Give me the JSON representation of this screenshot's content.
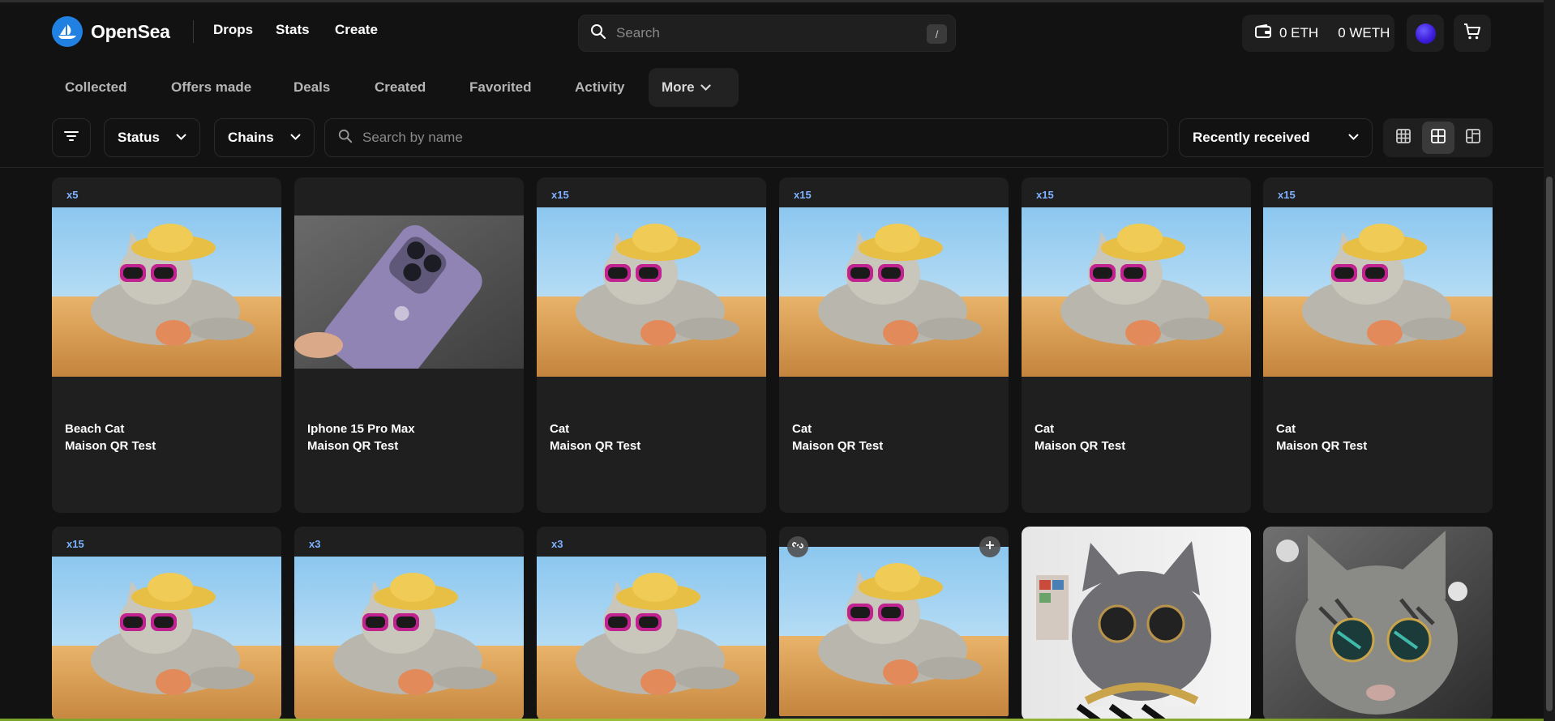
{
  "header": {
    "logo_text": "OpenSea",
    "nav": [
      "Drops",
      "Stats",
      "Create"
    ],
    "search_placeholder": "Search",
    "search_shortcut": "/",
    "wallet_eth": "0 ETH",
    "wallet_weth": "0 WETH"
  },
  "tabs": [
    "Collected",
    "Offers made",
    "Deals",
    "Created",
    "Favorited",
    "Activity",
    "More"
  ],
  "filters": {
    "status_label": "Status",
    "chains_label": "Chains",
    "search_placeholder": "Search by name",
    "sort_label": "Recently received"
  },
  "cards": [
    {
      "badge": "x5",
      "name": "Beach Cat",
      "collection": "Maison QR Test",
      "image": "beach-cat"
    },
    {
      "badge": "",
      "name": "Iphone 15 Pro Max",
      "collection": "Maison QR Test",
      "image": "iphone"
    },
    {
      "badge": "x15",
      "name": "Cat",
      "collection": "Maison QR Test",
      "image": "beach-cat"
    },
    {
      "badge": "x15",
      "name": "Cat",
      "collection": "Maison QR Test",
      "image": "beach-cat"
    },
    {
      "badge": "x15",
      "name": "Cat",
      "collection": "Maison QR Test",
      "image": "beach-cat"
    },
    {
      "badge": "x15",
      "name": "Cat",
      "collection": "Maison QR Test",
      "image": "beach-cat"
    },
    {
      "badge": "x15",
      "name": "",
      "collection": "",
      "image": "beach-cat"
    },
    {
      "badge": "x3",
      "name": "",
      "collection": "",
      "image": "beach-cat"
    },
    {
      "badge": "x3",
      "name": "",
      "collection": "",
      "image": "beach-cat"
    },
    {
      "badge": "",
      "name": "",
      "collection": "",
      "image": "beach-cat"
    },
    {
      "badge": "",
      "name": "",
      "collection": "",
      "image": "gray-cat-glasses"
    },
    {
      "badge": "",
      "name": "",
      "collection": "",
      "image": "tabby-cat-glasses"
    }
  ],
  "colors": {
    "background": "#121212",
    "card": "#1f1f1f",
    "brand_blue": "#2081e2",
    "badge_blue": "#7fb2ff"
  }
}
